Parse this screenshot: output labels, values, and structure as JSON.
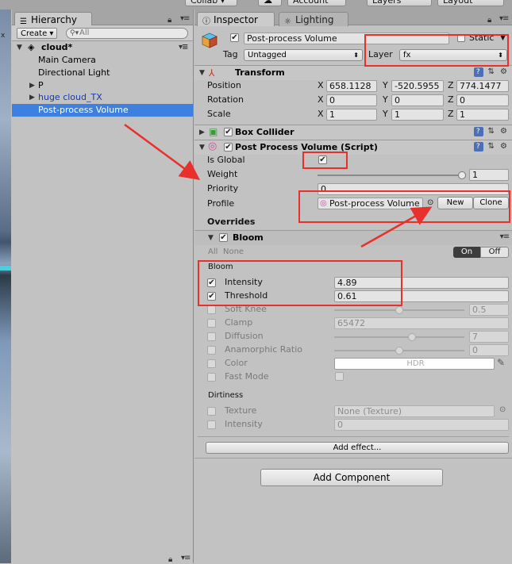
{
  "toolbar": {
    "collab_label": "Collab ▾",
    "account_label": "Account",
    "layers_label": "Layers",
    "layout_label": "Layout"
  },
  "scene_marker": "x",
  "hierarchy": {
    "tab_label": "Hierarchy",
    "create_label": "Create ▾",
    "search_placeholder": "All",
    "scene_name": "cloud*",
    "items": [
      {
        "label": "Main Camera"
      },
      {
        "label": "Directional Light"
      },
      {
        "label": "P"
      },
      {
        "label": "huge cloud_TX"
      },
      {
        "label": "Post-process Volume"
      }
    ]
  },
  "inspector": {
    "tab_inspector": "Inspector",
    "tab_lighting": "Lighting",
    "object_name": "Post-process Volume",
    "static_label": "Static",
    "tag_label": "Tag",
    "tag_value": "Untagged",
    "layer_label": "Layer",
    "layer_value": "fx",
    "transform": {
      "title": "Transform",
      "position_label": "Position",
      "rotation_label": "Rotation",
      "scale_label": "Scale",
      "axis_x": "X",
      "axis_y": "Y",
      "axis_z": "Z",
      "position": [
        "658.1128",
        "-520.5955",
        "774.1477"
      ],
      "rotation": [
        "0",
        "0",
        "0"
      ],
      "scale": [
        "1",
        "1",
        "1"
      ]
    },
    "box_collider_title": "Box Collider",
    "ppv": {
      "title": "Post Process Volume (Script)",
      "is_global_label": "Is Global",
      "weight_label": "Weight",
      "weight_value": "1",
      "weight_level": 1,
      "priority_label": "Priority",
      "priority_value": "0",
      "profile_label": "Profile",
      "profile_value": "Post-process Volume",
      "new_label": "New",
      "clone_label": "Clone",
      "overrides_label": "Overrides"
    },
    "bloom": {
      "title": "Bloom",
      "all_label": "All",
      "none_label": "None",
      "on_label": "On",
      "off_label": "Off",
      "group_label": "Bloom",
      "intensity_label": "Intensity",
      "intensity_value": "4.89",
      "threshold_label": "Threshold",
      "threshold_value": "0.61",
      "soft_knee_label": "Soft Knee",
      "soft_knee_value": "0.5",
      "soft_knee_level": 0.5,
      "clamp_label": "Clamp",
      "clamp_value": "65472",
      "diffusion_label": "Diffusion",
      "diffusion_value": "7",
      "diffusion_level": 0.6,
      "anamorphic_label": "Anamorphic Ratio",
      "anamorphic_value": "0",
      "anamorphic_level": 0.5,
      "color_label": "Color",
      "color_value": "HDR",
      "fast_mode_label": "Fast Mode",
      "dirtiness_label": "Dirtiness",
      "texture_label": "Texture",
      "texture_value": "None (Texture)",
      "dirt_intensity_label": "Intensity",
      "dirt_intensity_value": "0"
    },
    "add_effect_label": "Add effect...",
    "add_component_label": "Add Component"
  },
  "colors": {
    "selection": "#3d80df",
    "annotation_red": "#e8302c",
    "prefab_text": "#1a3aa8"
  }
}
